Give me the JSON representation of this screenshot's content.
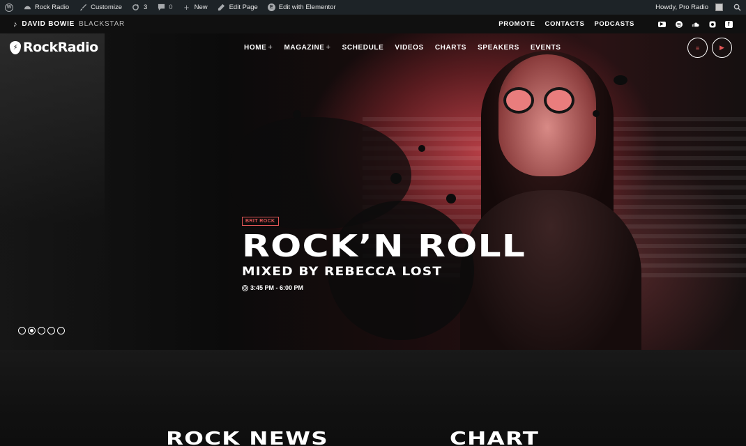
{
  "adminbar": {
    "site_name": "Rock Radio",
    "customize": "Customize",
    "updates_count": "3",
    "comments_count": "0",
    "new_label": "New",
    "edit_page": "Edit Page",
    "edit_elementor": "Edit with Elementor",
    "howdy": "Howdy, Pro Radio"
  },
  "topbar": {
    "now_playing_artist": "DAVID BOWIE",
    "now_playing_track": "BLACKSTAR",
    "links": [
      "PROMOTE",
      "CONTACTS",
      "PODCASTS"
    ],
    "socials": [
      "youtube-icon",
      "spotify-icon",
      "soundcloud-icon",
      "instagram-icon",
      "facebook-icon"
    ]
  },
  "nav": {
    "logo": "RockRadio",
    "items": [
      {
        "label": "HOME",
        "has_sub": true
      },
      {
        "label": "MAGAZINE",
        "has_sub": true
      },
      {
        "label": "SCHEDULE"
      },
      {
        "label": "VIDEOS"
      },
      {
        "label": "CHARTS"
      },
      {
        "label": "SPEAKERS"
      },
      {
        "label": "EVENTS"
      }
    ]
  },
  "hero": {
    "tag": "BRIT ROCK",
    "title": "ROCK’N ROLL",
    "subtitle": "MIXED BY REBECCA LOST",
    "time": "3:45 PM - 6:00 PM",
    "slides": 5,
    "active_slide": 2
  },
  "sections": {
    "news_title": "ROCK NEWS",
    "chart_title": "CHART"
  },
  "colors": {
    "accent": "#e25656",
    "adminbar_bg": "#1d2327",
    "topbar_bg": "#101010"
  }
}
